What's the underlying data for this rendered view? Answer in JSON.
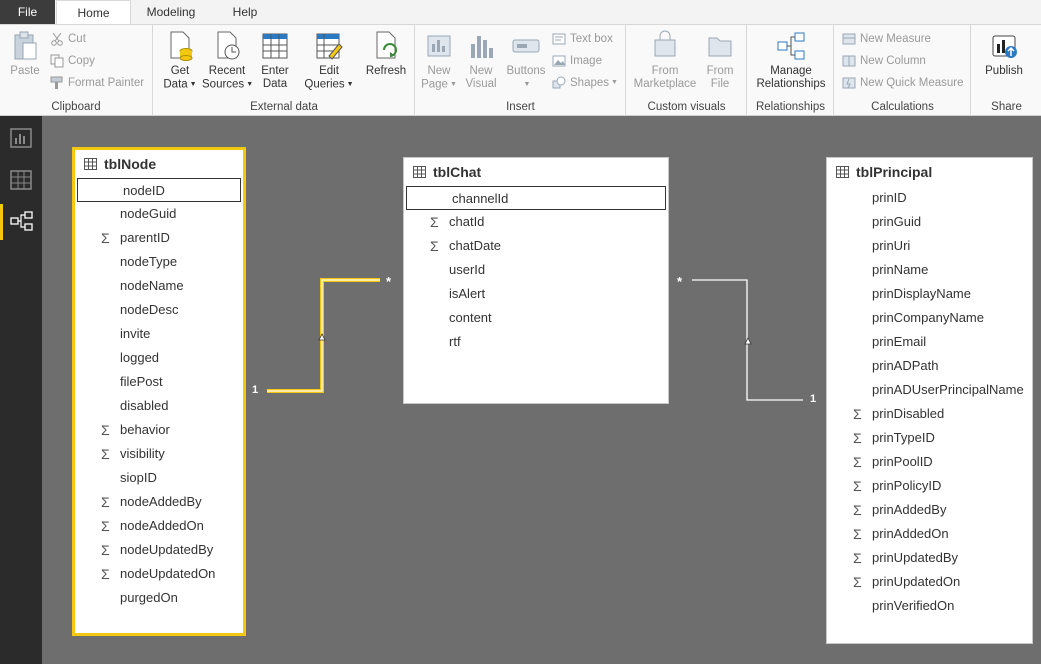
{
  "tabs": [
    {
      "label": "File"
    },
    {
      "label": "Home"
    },
    {
      "label": "Modeling"
    },
    {
      "label": "Help"
    }
  ],
  "ribbon": {
    "clipboard": {
      "label": "Clipboard",
      "paste": "Paste",
      "cut": "Cut",
      "copy": "Copy",
      "format_painter": "Format Painter"
    },
    "external": {
      "label": "External data",
      "get_data_1": "Get",
      "get_data_2": "Data",
      "recent_1": "Recent",
      "recent_2": "Sources",
      "enter_1": "Enter",
      "enter_2": "Data",
      "edit_1": "Edit",
      "edit_2": "Queries",
      "refresh": "Refresh"
    },
    "insert": {
      "label": "Insert",
      "new_page_1": "New",
      "new_page_2": "Page",
      "new_visual_1": "New",
      "new_visual_2": "Visual",
      "buttons": "Buttons",
      "text_box": "Text box",
      "image": "Image",
      "shapes": "Shapes"
    },
    "custom": {
      "label": "Custom visuals",
      "marketplace_1": "From",
      "marketplace_2": "Marketplace",
      "file_1": "From",
      "file_2": "File"
    },
    "relationships": {
      "label": "Relationships",
      "manage_1": "Manage",
      "manage_2": "Relationships"
    },
    "calculations": {
      "label": "Calculations",
      "new_measure": "New Measure",
      "new_column": "New Column",
      "new_quick_measure": "New Quick Measure"
    },
    "share": {
      "label": "Share",
      "publish": "Publish"
    }
  },
  "tables": {
    "node": {
      "name": "tblNode",
      "fields": [
        {
          "name": "nodeID",
          "sigma": false,
          "selected": true
        },
        {
          "name": "nodeGuid",
          "sigma": false
        },
        {
          "name": "parentID",
          "sigma": true
        },
        {
          "name": "nodeType",
          "sigma": false
        },
        {
          "name": "nodeName",
          "sigma": false
        },
        {
          "name": "nodeDesc",
          "sigma": false
        },
        {
          "name": "invite",
          "sigma": false
        },
        {
          "name": "logged",
          "sigma": false
        },
        {
          "name": "filePost",
          "sigma": false
        },
        {
          "name": "disabled",
          "sigma": false
        },
        {
          "name": "behavior",
          "sigma": true
        },
        {
          "name": "visibility",
          "sigma": true
        },
        {
          "name": "siopID",
          "sigma": false
        },
        {
          "name": "nodeAddedBy",
          "sigma": true
        },
        {
          "name": "nodeAddedOn",
          "sigma": true
        },
        {
          "name": "nodeUpdatedBy",
          "sigma": true
        },
        {
          "name": "nodeUpdatedOn",
          "sigma": true
        },
        {
          "name": "purgedOn",
          "sigma": false
        }
      ]
    },
    "chat": {
      "name": "tblChat",
      "fields": [
        {
          "name": "channelId",
          "sigma": false,
          "selected": true
        },
        {
          "name": "chatId",
          "sigma": true
        },
        {
          "name": "chatDate",
          "sigma": true
        },
        {
          "name": "userId",
          "sigma": false
        },
        {
          "name": "isAlert",
          "sigma": false
        },
        {
          "name": "content",
          "sigma": false
        },
        {
          "name": "rtf",
          "sigma": false
        }
      ]
    },
    "principal": {
      "name": "tblPrincipal",
      "fields": [
        {
          "name": "prinID",
          "sigma": false
        },
        {
          "name": "prinGuid",
          "sigma": false
        },
        {
          "name": "prinUri",
          "sigma": false
        },
        {
          "name": "prinName",
          "sigma": false
        },
        {
          "name": "prinDisplayName",
          "sigma": false
        },
        {
          "name": "prinCompanyName",
          "sigma": false
        },
        {
          "name": "prinEmail",
          "sigma": false
        },
        {
          "name": "prinADPath",
          "sigma": false
        },
        {
          "name": "prinADUserPrincipalName",
          "sigma": false
        },
        {
          "name": "prinDisabled",
          "sigma": true
        },
        {
          "name": "prinTypeID",
          "sigma": true
        },
        {
          "name": "prinPoolID",
          "sigma": true
        },
        {
          "name": "prinPolicyID",
          "sigma": true
        },
        {
          "name": "prinAddedBy",
          "sigma": true
        },
        {
          "name": "prinAddedOn",
          "sigma": true
        },
        {
          "name": "prinUpdatedBy",
          "sigma": true
        },
        {
          "name": "prinUpdatedOn",
          "sigma": true
        },
        {
          "name": "prinVerifiedOn",
          "sigma": false
        }
      ]
    }
  },
  "relationships": {
    "node_chat": {
      "one": "1",
      "many": "*"
    },
    "chat_principal": {
      "one": "1",
      "many": "*"
    }
  },
  "colors": {
    "highlight": "#f2c811",
    "nav_bg": "#2b2b2b",
    "canvas_bg": "#6e6e6e"
  }
}
